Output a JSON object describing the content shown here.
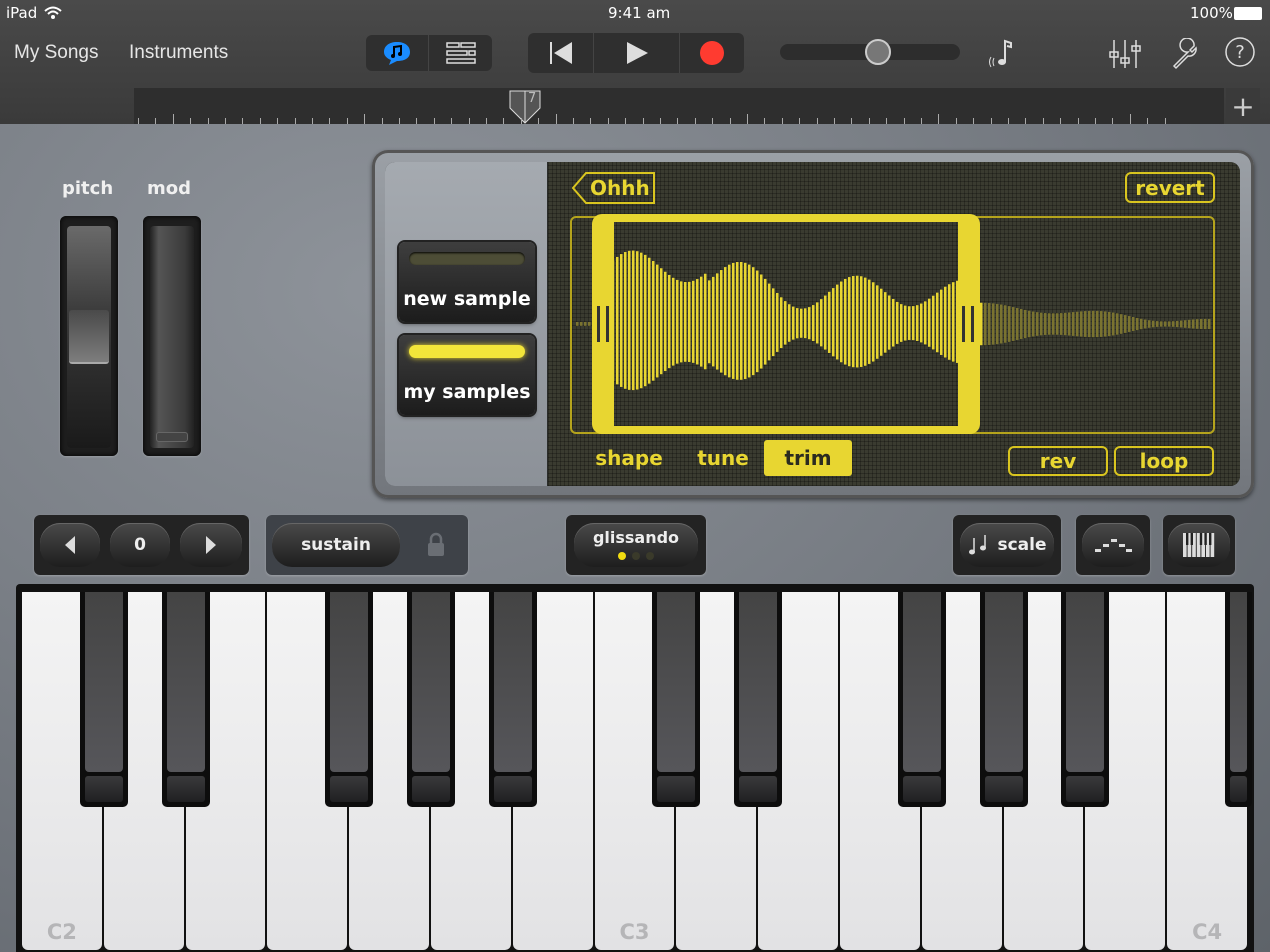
{
  "status_bar": {
    "device": "iPad",
    "time": "9:41 am",
    "battery": "100%"
  },
  "nav": {
    "my_songs": "My Songs",
    "instruments": "Instruments"
  },
  "view_toggle": [
    {
      "icon": "instrument-view-icon",
      "active": true
    },
    {
      "icon": "tracks-view-icon",
      "active": false
    }
  ],
  "transport": [
    {
      "icon": "go-to-beginning-icon"
    },
    {
      "icon": "play-icon"
    },
    {
      "icon": "record-icon"
    }
  ],
  "colors": {
    "accent_blue": "#1a8cff",
    "record_red": "#ff3b30",
    "lcd_yellow": "#e8d631"
  },
  "volume": {
    "value": 0.5
  },
  "ruler": {
    "playhead_bar": "7"
  },
  "controls": {
    "pitch_label": "pitch",
    "mod_label": "mod",
    "pitch_value": 0.5,
    "mod_value": 0.0
  },
  "sampler": {
    "new_sample": "new sample",
    "my_samples": "my samples",
    "sample_name": "Ohhh",
    "revert": "revert",
    "tabs": [
      {
        "label": "shape",
        "active": false
      },
      {
        "label": "tune",
        "active": false
      },
      {
        "label": "trim",
        "active": true
      }
    ],
    "rev": "rev",
    "loop": "loop"
  },
  "octave": {
    "value": "0"
  },
  "sustain": "sustain",
  "glissando": {
    "label": "glissando",
    "mode_index": 0,
    "modes": 3
  },
  "scale": "scale",
  "keyboard": {
    "labels": [
      "C2",
      "C3",
      "C4"
    ]
  }
}
